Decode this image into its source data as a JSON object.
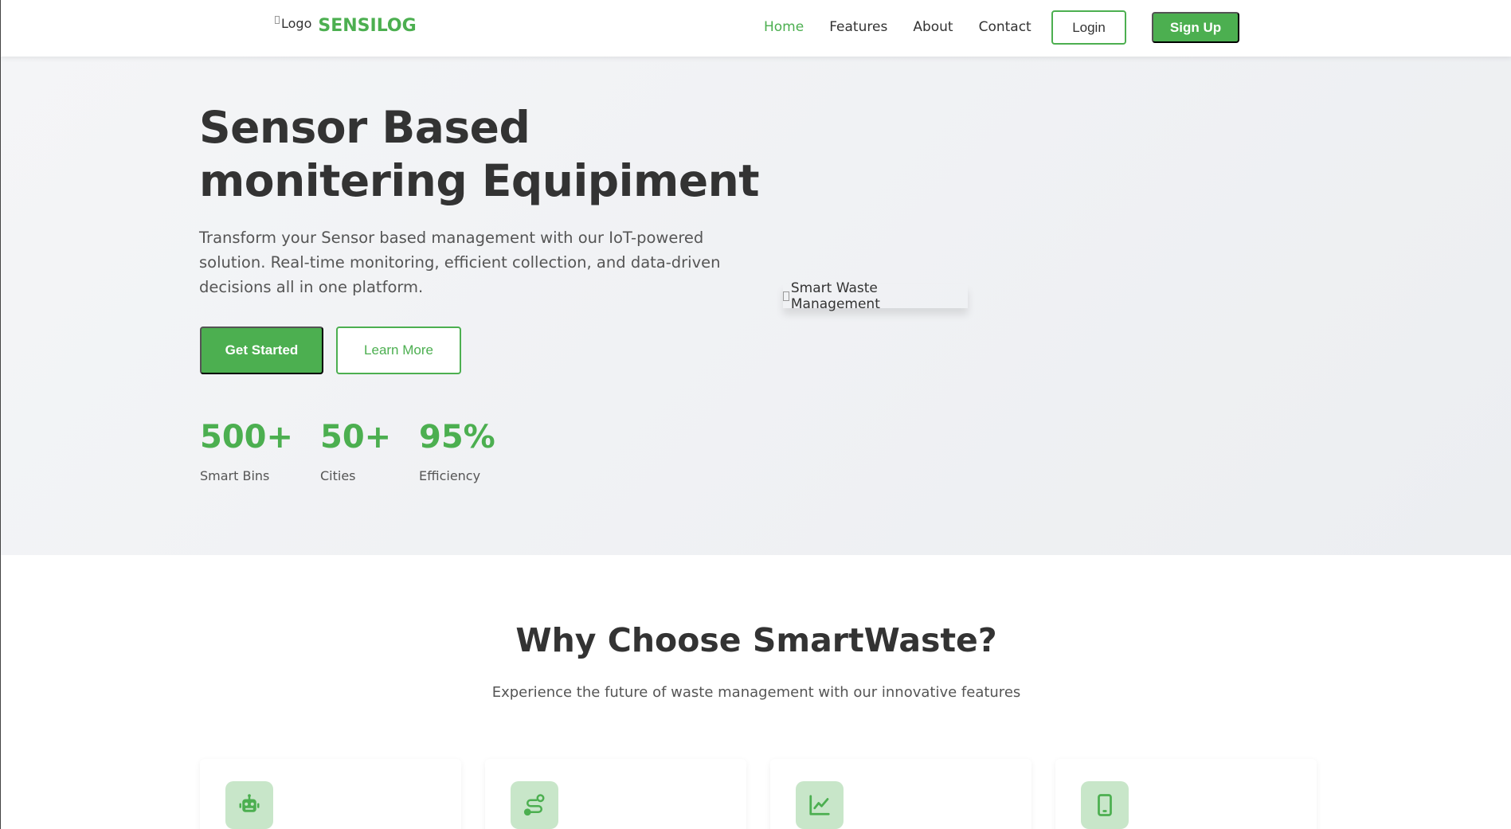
{
  "navbar": {
    "logo_alt": "Logo",
    "brand": "SENSILOG",
    "links": [
      "Home",
      "Features",
      "About",
      "Contact"
    ],
    "login_label": "Login",
    "signup_label": "Sign Up"
  },
  "hero": {
    "title_line1": "Sensor Based",
    "title_line2": "monitering Equipiment",
    "description": "Transform your Sensor based management with our IoT-powered solution. Real-time monitoring, efficient collection, and data-driven decisions all in one platform.",
    "get_started_label": "Get Started",
    "learn_more_label": "Learn More",
    "image_alt": "Smart Waste Management",
    "stats": [
      {
        "value": "500+",
        "label": "Smart Bins"
      },
      {
        "value": "50+",
        "label": "Cities"
      },
      {
        "value": "95%",
        "label": "Efficiency"
      }
    ]
  },
  "features": {
    "title": "Why Choose SmartWaste?",
    "subtitle": "Experience the future of waste management with our innovative features",
    "cards": [
      {
        "icon": "robot-icon"
      },
      {
        "icon": "route-icon"
      },
      {
        "icon": "chart-line-icon"
      },
      {
        "icon": "mobile-icon"
      }
    ]
  },
  "colors": {
    "accent": "#4caf50",
    "icon_bg": "#c8e6c9",
    "text_dark": "#333333",
    "text_muted": "#555555"
  }
}
